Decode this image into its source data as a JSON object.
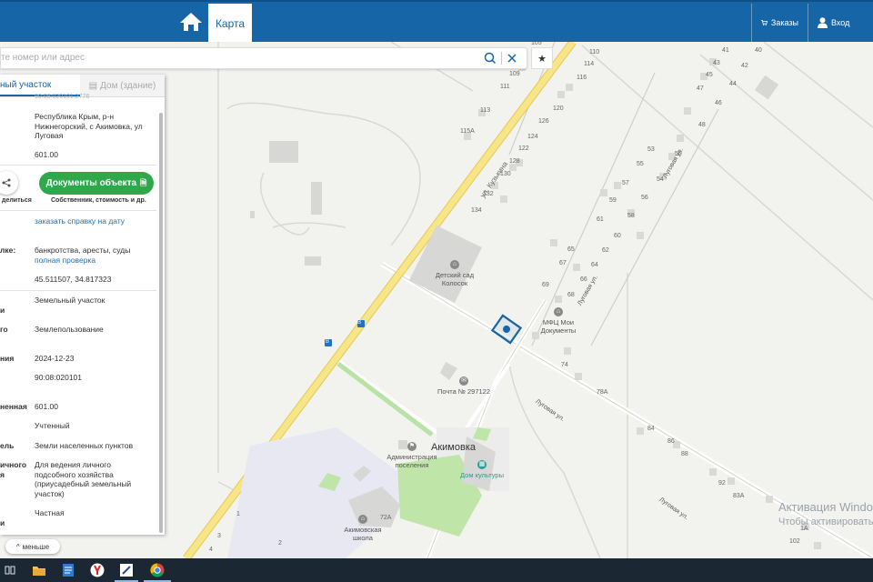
{
  "topbar": {
    "map_tab": "Карта",
    "orders": "Заказы",
    "login": "Вход"
  },
  "search": {
    "placeholder": "те номер или адрес"
  },
  "panel": {
    "tab_land": "ный участок",
    "tab_building": "Дом (здание)",
    "cut_number": "90:08:020101:2776",
    "address": "Республика Крым, р-н Нижнегорский, с Акимовка, ул Луговая",
    "area_top": "601.00",
    "docs_button": "Документы объекта",
    "docs_sub": "Собственник, стоимость и др.",
    "share_label": "делиться",
    "order_link": "заказать справку на дату",
    "check_label": "лке:",
    "check_text": "банкротства, аресты, суды",
    "full_check": "полная проверка",
    "coords": "45.511507, 34.817323",
    "type_label": "и",
    "type_value": "Земельный участок",
    "kind_label": "го",
    "kind_value": "Землепользование",
    "date_label": "ния",
    "date_value": "2024-12-23",
    "quarter_value": "90:08:020101",
    "area_label": "ненная",
    "area_value": "601.00",
    "status_value": "Учтенный",
    "category_label": "ель",
    "category_value": "Земли населенных пунктов",
    "use_label1": "ичного",
    "use_label2": "я",
    "use_value": "Для ведения личного подсобного хозяйства (приусадебный земельный участок)",
    "ownership_label": "и",
    "ownership_value": "Частная",
    "less_button": "меньше"
  },
  "map": {
    "street_kuzkina": "ул. Кузькина",
    "street_lugovaya1": "Луговая ул.",
    "street_lugovaya2": "Луговая ул.",
    "street_lugovaya3": "Луговая ул.",
    "street_lugovaya4": "Луговая ул.",
    "kindergarten": "Детский сад Колосок",
    "mfc": "МФЦ Мои Документы",
    "post": "Почта № 297122",
    "village": "Акимовка",
    "admin": "Администрация поселения",
    "culture": "Дом культуры",
    "school": "Акимовская школа",
    "numbers": [
      "105",
      "110",
      "114",
      "116",
      "109",
      "111",
      "113",
      "115А",
      "126",
      "120",
      "124",
      "122",
      "128",
      "130",
      "132",
      "134",
      "41",
      "40",
      "43",
      "42",
      "45",
      "44",
      "47",
      "46",
      "48",
      "50",
      "53",
      "55",
      "57",
      "54",
      "59",
      "56",
      "58",
      "61",
      "60",
      "65",
      "62",
      "67",
      "64",
      "66",
      "69",
      "68",
      "74",
      "78А",
      "84",
      "86",
      "88",
      "92",
      "83А",
      "1А",
      "102",
      "72А",
      "1",
      "2",
      "3",
      "4"
    ],
    "bus1": "B",
    "bus2": "B"
  },
  "watermark": {
    "line1": "Активация Windo",
    "line2": "Чтобы активировать W"
  },
  "colors": {
    "topbar": "#1565a7",
    "green_button": "#2ea84a",
    "road_yellow": "#f5e27a",
    "link": "#1a73b8"
  }
}
